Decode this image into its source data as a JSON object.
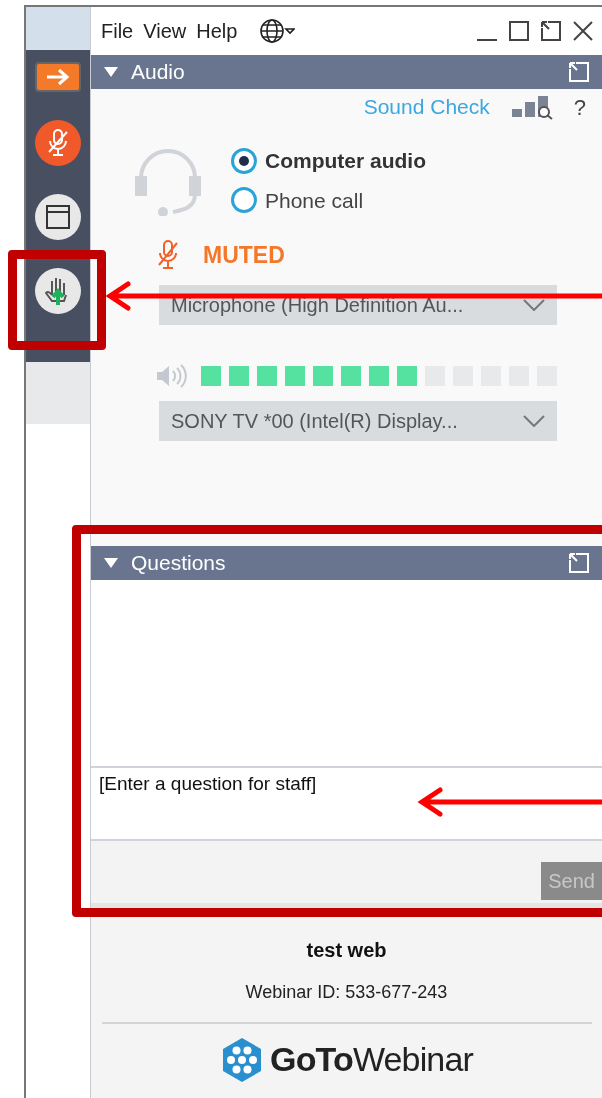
{
  "menu": [
    "File",
    "View",
    "Help"
  ],
  "audio": {
    "title": "Audio",
    "sound_check": "Sound Check",
    "help": "?",
    "options": [
      {
        "label": "Computer audio",
        "selected": true
      },
      {
        "label": "Phone call",
        "selected": false
      }
    ],
    "status": "MUTED",
    "microphone": "Microphone (High Definition Au...",
    "speaker_level": {
      "level": 0.615
    },
    "speaker": "SONY TV  *00 (Intel(R)  Display..."
  },
  "questions": {
    "title": "Questions",
    "placeholder": "[Enter a question for staff]",
    "send": {
      "label": "Send",
      "disabled": true
    }
  },
  "footer": {
    "title": "test web",
    "webinar_id": "Webinar ID: 533-677-243",
    "logo": "**GoTo**Webinar"
  }
}
